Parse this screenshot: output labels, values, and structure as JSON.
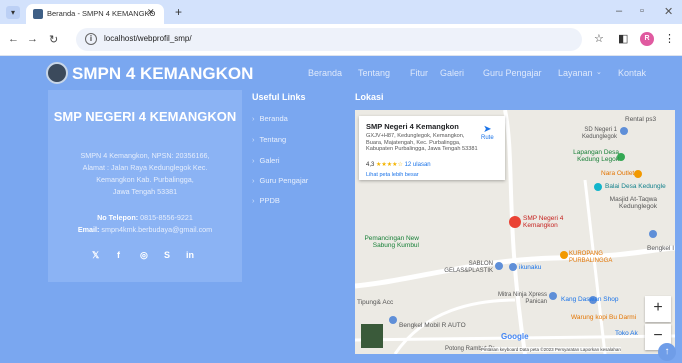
{
  "browser": {
    "tab_title": "Beranda - SMPN 4 KEMANGKO",
    "url": "localhost/webprofil_smp/",
    "new_tab_label": "+",
    "profile_initial": "R"
  },
  "header": {
    "brand": "SMPN 4 KEMANGKON",
    "menu": [
      "Beranda",
      "Tentang",
      "Fitur",
      "Galeri",
      "Guru Pengajar",
      "Layanan",
      "Kontak"
    ]
  },
  "footer": {
    "school_name": "SMP NEGERI 4 KEMANGKON",
    "address": [
      "SMPN 4 Kemangkon, NPSN: 20356166,",
      "Alamat : Jalan Raya Kedunglegok Kec.",
      "Kemangkon Kab. Purbalingga,",
      "Jawa Tengah 53381"
    ],
    "phone_label": "No Telepon:",
    "phone": "0815-8556-9221",
    "email_label": "Email:",
    "email": "smpn4kmk.berbudaya@gmail.com",
    "useful_links_title": "Useful Links",
    "links": [
      "Beranda",
      "Tentang",
      "Galeri",
      "Guru Pengajar",
      "PPDB"
    ],
    "location_title": "Lokasi"
  },
  "map": {
    "card_name": "SMP Negeri 4 Kemangkon",
    "card_address": "GXJV+H87, Kedunglegok, Kemangkon, Buara, Majatengah, Kec. Purbalingga, Kabupaten Purbalingga, Jawa Tengah 53381",
    "rating": "4,3",
    "stars": "★★★★☆",
    "reviews": "12 ulasan",
    "larger_map": "Lihat peta lebih besar",
    "route": "Rute",
    "labels": [
      "Rental ps3",
      "SD Negeri 1 Kedunglegok",
      "Lapangan Desa Kedung Legok",
      "Nara Outlet",
      "Balai Desa Kedungle",
      "Masjid At-Taqwa Kedunglegok",
      "SMP Negeri 4 Kemangkon",
      "Pemancingan New Sabung Kumbul",
      "KUROPANG PURBALINGGA",
      "SABLON GELAS&PLASTIK",
      "ikunaku",
      "Bengkel I",
      "Tipung& Acc",
      "Mitra Ninja Xpress Panican",
      "Kang Daswan Shop",
      "Warung kopi Bu Darmi",
      "Bengkel Mobil R AUTO",
      "Toko Ak",
      "Potong Rambut Pr",
      "Google"
    ],
    "attribution": "Pintasan keyboard  Data peta ©2023  Persyaratan  Laporkan kesalahan"
  }
}
